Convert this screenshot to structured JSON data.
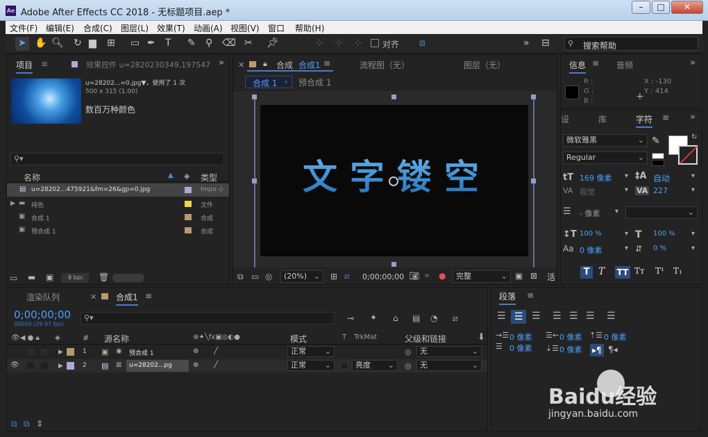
{
  "window": {
    "title": "Adobe After Effects CC 2018 - 无标题项目.aep *",
    "app_badge": "Ae",
    "min": "–",
    "max": "□",
    "close": "✕"
  },
  "menu": [
    "文件(F)",
    "编辑(E)",
    "合成(C)",
    "图层(L)",
    "效果(T)",
    "动画(A)",
    "视图(V)",
    "窗口",
    "帮助(H)"
  ],
  "toolbar": {
    "snap_label": "对齐",
    "search_placeholder": "搜索帮助"
  },
  "project": {
    "tab": "项目",
    "effects_tab": "效果控件 u=2820230349,197547",
    "item_name": "u=28202...=0.jpg▼，使用了 1 次",
    "item_size": "500 x 315 (1.00)",
    "item_color": "数百万种颜色",
    "col_name": "名称",
    "col_type": "类型",
    "rows": [
      {
        "name": "u=28202...475921&fm=26&gp=0.jpg",
        "type": "Impo",
        "color": "#b0a8d8"
      },
      {
        "name": "纯色",
        "type": "文件",
        "color": "#e8d84a"
      },
      {
        "name": "合成 1",
        "type": "合成",
        "color": "#b89a6e"
      },
      {
        "name": "预合成 1",
        "type": "合成",
        "color": "#b89a6e"
      }
    ],
    "bpc": "8 bpc"
  },
  "comp": {
    "tab_prefix": "合成",
    "tab_name": "合成1",
    "flow_tab": "流程图（无）",
    "layer_tab": "图层（无）",
    "breadcrumb1": "合成 1",
    "breadcrumb2": "预合成 1",
    "viewer_text": "文字镂空",
    "zoom": "(20%)",
    "timecode": "0;00;00;00",
    "quality": "完整",
    "extra": "活"
  },
  "info": {
    "tab1": "信息",
    "tab2": "音频",
    "r": "R :",
    "g": "G :",
    "b": "B :",
    "x": "X : -130",
    "y": "Y : 414"
  },
  "character": {
    "tab1": "设",
    "tab2": "库",
    "tab3": "字符",
    "font": "微软雅黑",
    "style": "Regular",
    "size": "169 像素",
    "leading": "自动",
    "kerning": "视觉",
    "tracking": "227",
    "stroke": "- 像素",
    "vscale": "100 %",
    "hscale": "100 %",
    "baseline": "0 像素",
    "tsume": "0 %"
  },
  "paragraph": {
    "tab": "段落",
    "indent_left": "0 像素",
    "indent_first": "0 像素",
    "indent_right": "0 像素",
    "space_before": "0 像素",
    "space_after": "0 像素"
  },
  "timeline": {
    "tab_render": "渲染队列",
    "tab_comp": "合成1",
    "timecode": "0;00;00;00",
    "fps": "00000 (29.97 fps)",
    "col_hash": "#",
    "col_source": "源名称",
    "col_mode": "模式",
    "col_t": "T",
    "col_trkmat": "TrkMat",
    "col_parent": "父级和链接",
    "layers": [
      {
        "num": "1",
        "name": "预合成 1",
        "mode": "正常",
        "trkmat": "",
        "parent": "无",
        "color": "#b89a6e"
      },
      {
        "num": "2",
        "name": "u=28202...pg",
        "mode": "正常",
        "trkmat": "亮度",
        "parent": "无",
        "color": "#b0a8d8"
      }
    ]
  },
  "watermark": {
    "brand": "Baidu经验",
    "url": "jingyan.baidu.com"
  }
}
